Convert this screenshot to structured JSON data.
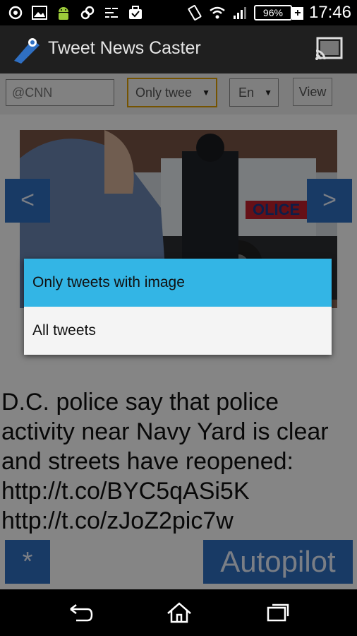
{
  "status_bar": {
    "battery": "96%",
    "time": "17:46",
    "icons": [
      "settings-icon",
      "gallery-icon",
      "android-icon",
      "link-icon",
      "equalizer-icon",
      "briefcase-icon",
      "vibrate-icon",
      "wifi-icon",
      "signal-icon",
      "battery-charging-icon"
    ]
  },
  "app_bar": {
    "title": "Tweet News Caster",
    "icons": [
      "app-logo-icon",
      "cast-icon"
    ]
  },
  "controls": {
    "account_value": "@CNN",
    "filter_value": "Only twee",
    "language_value": "En",
    "view_label": "View"
  },
  "content": {
    "prev_label": "<",
    "next_label": ">",
    "tweet_text": "D.C. police say that police activity near Navy Yard is clear and streets have reopened: http://t.co/BYC5qASi5K http://t.co/zJoZ2pic7w",
    "star_label": "*",
    "autopilot_label": "Autopilot",
    "image_overlay_text": "OLICE"
  },
  "dialog": {
    "options": [
      {
        "label": "Only tweets with image",
        "selected": true
      },
      {
        "label": "All tweets",
        "selected": false
      }
    ],
    "accent_color": "#33b5e5"
  },
  "nav_bar": {
    "icons": [
      "back-icon",
      "home-icon",
      "recent-apps-icon"
    ]
  },
  "colors": {
    "button_blue": "#2f6fc2",
    "highlight": "#33b5e5",
    "app_bar": "#1f1f1f"
  }
}
